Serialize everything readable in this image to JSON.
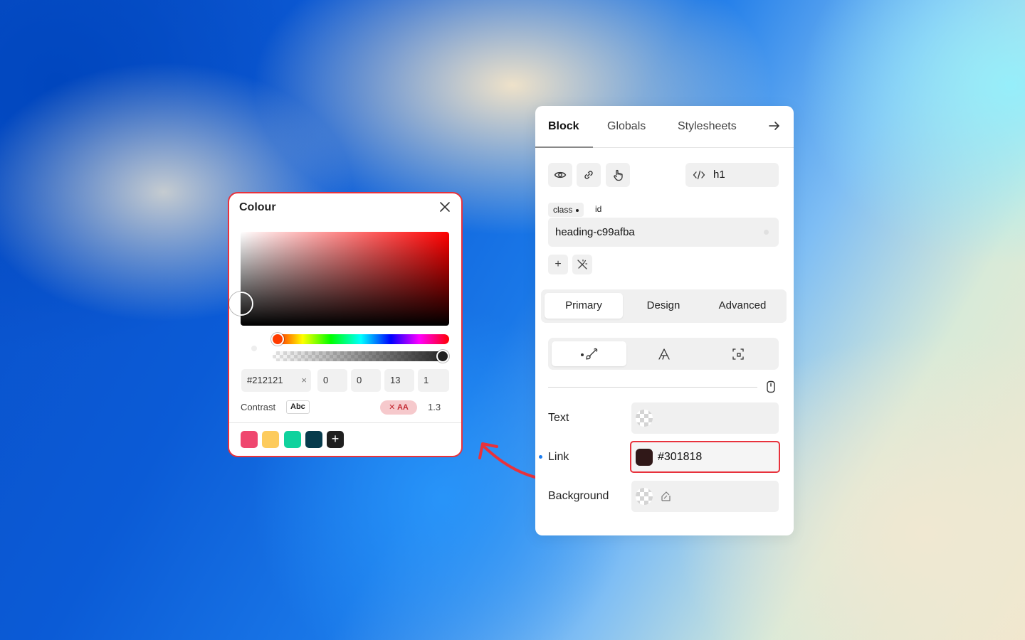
{
  "colour_picker": {
    "title": "Colour",
    "hex": "#212121",
    "r": "0",
    "g": "0",
    "b": "13",
    "a": "1",
    "clear_glyph": "×",
    "contrast_label": "Contrast",
    "sample_text": "Abc",
    "aa_badge": "✕ AA",
    "contrast_ratio": "1.3",
    "alpha_fraction": 1.0,
    "swatches": [
      "#ef476f",
      "#fdcb5c",
      "#0fd29d",
      "#073b4c"
    ],
    "add_swatch_glyph": "+"
  },
  "panel": {
    "tabs": [
      "Block",
      "Globals",
      "Stylesheets"
    ],
    "active_tab": "Block",
    "tag": "h1",
    "selector_chips": {
      "class": "class",
      "id": "id"
    },
    "class_name": "heading-c99afba",
    "add_glyph": "+",
    "sections": [
      "Primary",
      "Design",
      "Advanced"
    ],
    "active_section": "Primary",
    "properties": {
      "text_label": "Text",
      "link_label": "Link",
      "link_value": "#301818",
      "background_label": "Background"
    }
  },
  "colors": {
    "highlight_red": "#e8323c",
    "link_swatch": "#301818",
    "indicator_blue": "#1a7cf0"
  },
  "icons": [
    "close-icon",
    "arrow-right-icon",
    "eye-icon",
    "link-icon",
    "hand-pointer-icon",
    "code-icon",
    "magic-wand-icon",
    "brush-icon",
    "typography-icon",
    "spacing-icon",
    "mouse-icon",
    "image-icon",
    "curved-arrow-icon"
  ]
}
